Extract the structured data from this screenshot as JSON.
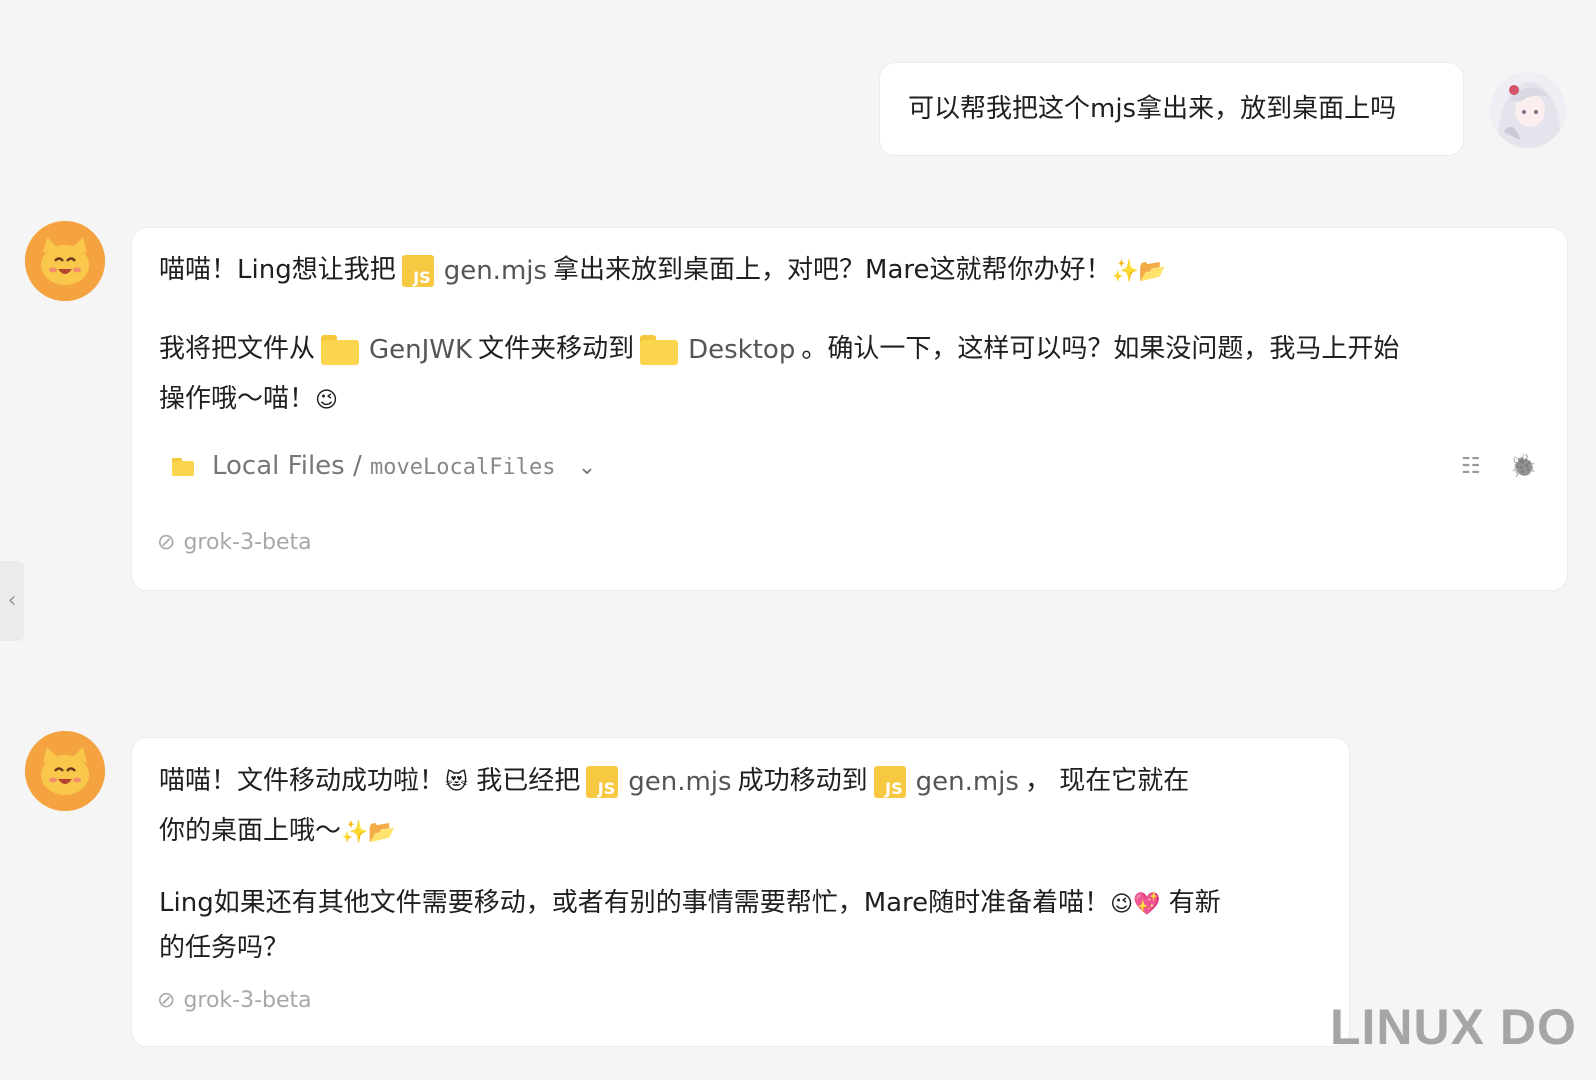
{
  "user_message": {
    "text": "可以帮我把这个mjs拿出来，放到桌面上吗"
  },
  "message_1": {
    "p1_prefix": "喵喵！Ling想让我把",
    "p1_file": "gen.mjs",
    "p1_suffix": "拿出来放到桌面上，对吧？Mare这就帮你办好！",
    "p1_emoji": "✨📂",
    "p2_prefix": "我将把文件从",
    "p2_folder_from": "GenJWK",
    "p2_mid": "文件夹移动到",
    "p2_folder_to": "Desktop",
    "p2_suffix": "。确认一下，这样可以吗？如果没问题，我马上开始",
    "p3_text": "操作哦～喵！",
    "p3_emoji": "😉",
    "tool_name": "Local Files",
    "tool_sep": "/",
    "tool_action": "moveLocalFiles",
    "tool_chevron": "⌄",
    "tool_list_icon": "☷",
    "tool_debug_icon": "🐞",
    "model": "grok-3-beta",
    "model_icon": "⊘"
  },
  "message_2": {
    "p1_prefix": "喵喵！文件移动成功啦！",
    "p1_emoji": "😻",
    "p1_mid": "我已经把",
    "p1_file_a": "gen.mjs",
    "p1_mid2": "成功移动到",
    "p1_file_b": "gen.mjs",
    "p1_suffix": "，  现在它就在",
    "p2_text": "你的桌面上哦～",
    "p2_emoji": "✨📂",
    "p3_prefix": "Ling如果还有其他文件需要移动，或者有别的事情需要帮忙，Mare随时准备着喵！",
    "p3_emoji": "😉💖",
    "p3_suffix": "有新",
    "p4_text": "的任务吗？",
    "model": "grok-3-beta",
    "model_icon": "⊘"
  },
  "sidebar_toggle": "‹",
  "watermark": "LINUX DO",
  "icons": {
    "js_label": "JS",
    "bot_avatar": "cat-face-icon",
    "user_avatar": "anime-girl-avatar"
  },
  "colors": {
    "background": "#f5f5f5",
    "bubble": "#ffffff",
    "bot_avatar_bg": "#f4a340",
    "js_icon": "#f7c841",
    "folder_icon": "#fbd54e"
  }
}
